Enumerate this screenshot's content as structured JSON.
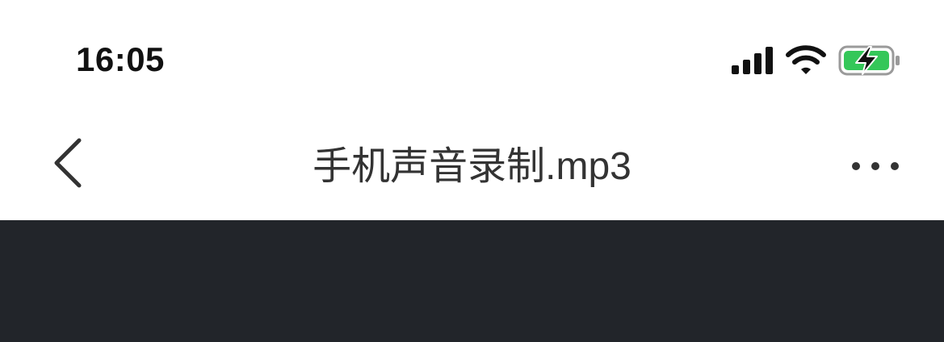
{
  "status_bar": {
    "time": "16:05",
    "signal_icon": "cellular-signal-icon",
    "wifi_icon": "wifi-icon",
    "battery_icon": "battery-charging-icon",
    "battery_color": "#34c759"
  },
  "nav": {
    "back_icon": "chevron-left-icon",
    "title": "手机声音录制.mp3",
    "more_icon": "more-horizontal-icon"
  },
  "colors": {
    "content_background": "#22252a",
    "title_text": "#333333"
  }
}
